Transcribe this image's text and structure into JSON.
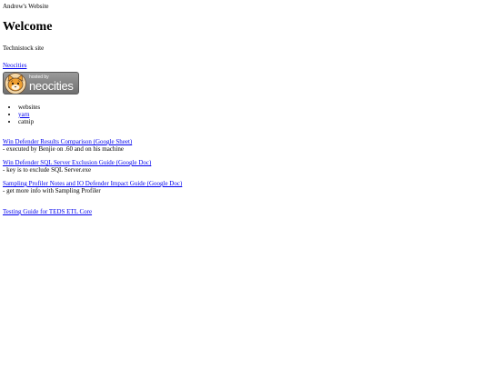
{
  "site": {
    "name": "Andrew's Website",
    "heading": "Welcome",
    "subtitle": "Technistock site"
  },
  "neocities_link": "Neocities",
  "badge": {
    "small_text": "hosted by",
    "big_text": "neocities",
    "icon": "neocities-cat-icon"
  },
  "list": [
    {
      "label": "websites",
      "is_link": false
    },
    {
      "label": "yarn",
      "is_link": true
    },
    {
      "label": "catnip",
      "is_link": false
    }
  ],
  "entries": [
    {
      "link": "Win Defender Results Comparison (Google Sheet)",
      "desc": "- executed by Benjie on .60 and on his machine"
    },
    {
      "link": "Win Defender SQL Server Exclusion Guide (Google Doc)",
      "desc": "- key is to exclude SQL Server.exe"
    },
    {
      "link": "Sampling Profiler Notes and IO Defender Impact Guide (Google Doc)",
      "desc": "- get more info with Sampling Profiler"
    }
  ],
  "testing_link": "Testing Guide for TEDS ETL Core",
  "colors": {
    "link": "#0000ee",
    "badge_bg": "#808080",
    "cat_orange": "#f0a030"
  }
}
